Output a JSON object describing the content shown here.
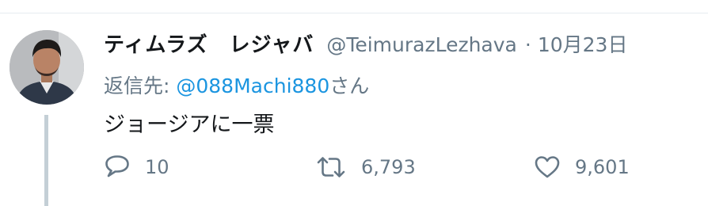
{
  "tweet": {
    "author": {
      "display_name": "ティムラズ　レジャバ",
      "handle": "@TeimurazLezhava",
      "avatar": "avatar-photo"
    },
    "separator": "·",
    "date": "10月23日",
    "reply_to": {
      "prefix": "返信先: ",
      "mention": "@088Machi880",
      "suffix": "さん"
    },
    "text": "ジョージアに一票",
    "actions": {
      "reply": {
        "icon": "reply-icon",
        "count": "10"
      },
      "retweet": {
        "icon": "retweet-icon",
        "count": "6,793"
      },
      "like": {
        "icon": "heart-icon",
        "count": "9,601"
      }
    }
  },
  "colors": {
    "text_primary": "#14171a",
    "text_secondary": "#657786",
    "link": "#1b95e0",
    "divider": "#e6ecf0",
    "thread_line": "#c4cfd6"
  }
}
